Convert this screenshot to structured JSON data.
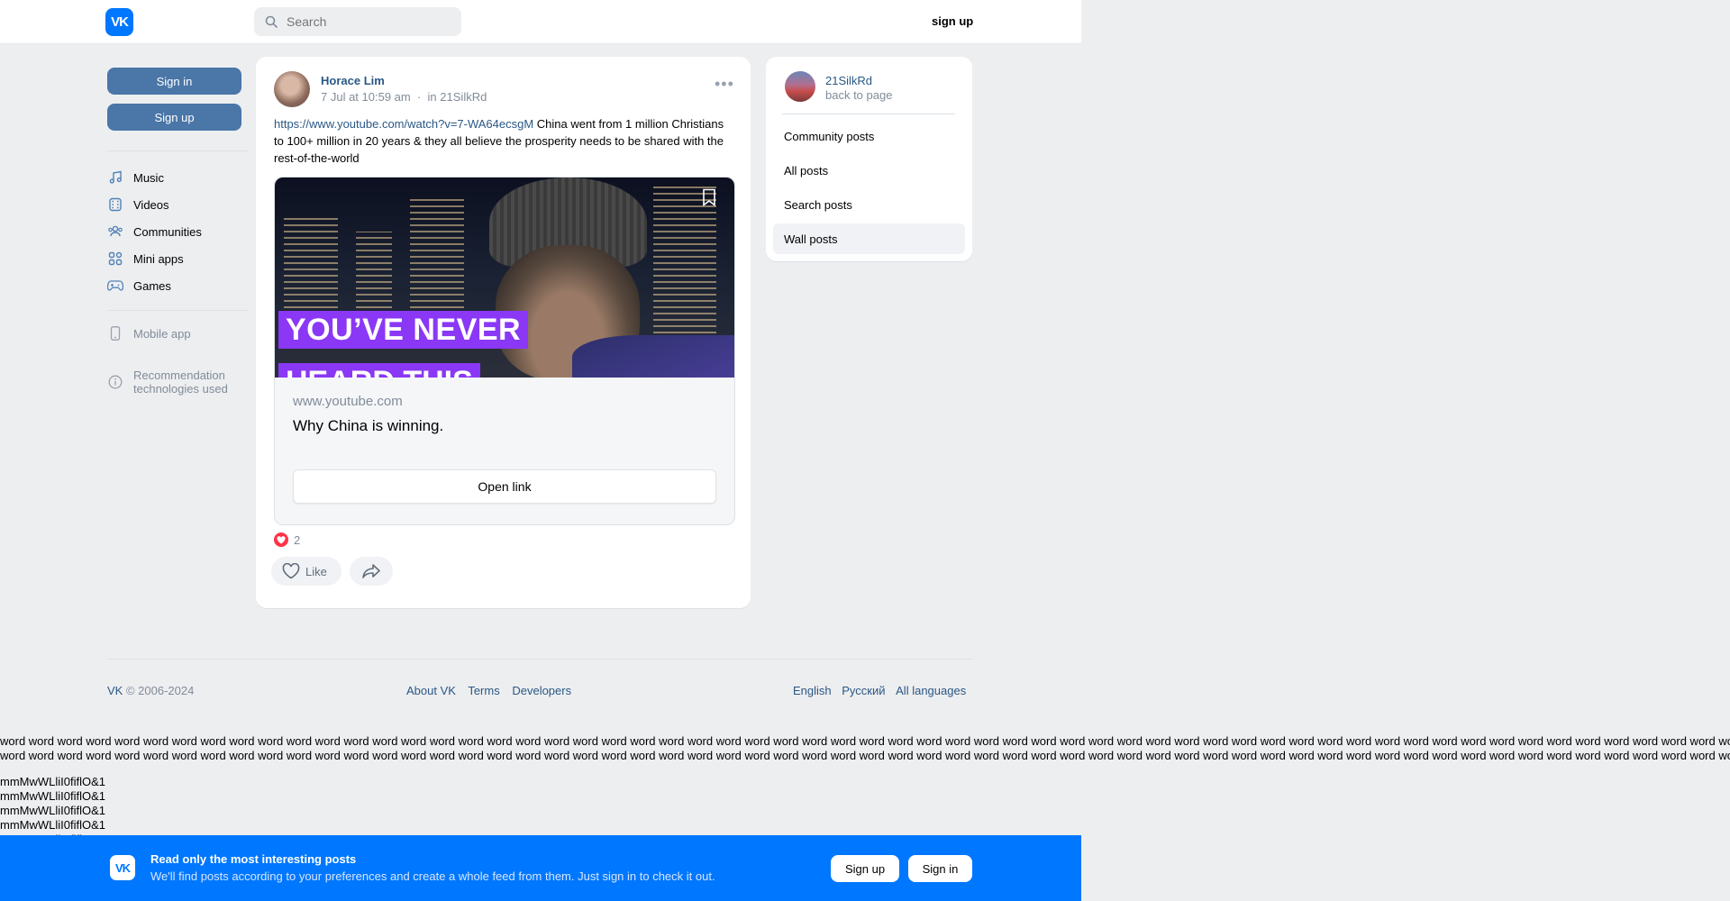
{
  "header": {
    "logo": "VK",
    "search_placeholder": "Search",
    "signup_label": "sign up"
  },
  "sidebar": {
    "signin_label": "Sign in",
    "signup_label": "Sign up",
    "items": [
      {
        "label": "Music",
        "icon": "music-icon"
      },
      {
        "label": "Videos",
        "icon": "video-icon"
      },
      {
        "label": "Communities",
        "icon": "communities-icon"
      },
      {
        "label": "Mini apps",
        "icon": "mini-apps-icon"
      },
      {
        "label": "Games",
        "icon": "games-icon"
      }
    ],
    "mobile_app_label": "Mobile app",
    "recommendation_label_1": "Recommendation",
    "recommendation_label_2": "technologies used"
  },
  "post": {
    "author": "Horace Lim",
    "date": "7 Jul at 10:59 am",
    "separator": "·",
    "group_prefix": "in",
    "group": "21SilkRd",
    "link_url": "https://www.youtube.com/watch?v=7-WA64ecsgM",
    "text": " China went from 1 million Christians to 100+ million in 20 years & they all believe the prosperity needs to be shared with the rest-of-the-world",
    "attachment": {
      "banner_line_1": "YOU’VE NEVER",
      "banner_line_2": "HEARD THIS",
      "domain": "www.youtube.com",
      "title": "Why China is winning.",
      "open_label": "Open link"
    },
    "reactions_count": "2",
    "like_label": "Like"
  },
  "side": {
    "name": "21SilkRd",
    "back_label": "back to page",
    "items": [
      {
        "label": "Community posts",
        "active": false
      },
      {
        "label": "All posts",
        "active": false
      },
      {
        "label": "Search posts",
        "active": false
      },
      {
        "label": "Wall posts",
        "active": true
      }
    ]
  },
  "footer": {
    "copyright_brand": "VK",
    "copyright_rest": " © 2006-2024",
    "links": [
      "About VK",
      "Terms",
      "Developers"
    ],
    "languages": [
      "English",
      "Русский",
      "All languages"
    ]
  },
  "filler": {
    "words_line": "word word word word word word word word word word word word word word word word word word word word word word word word word word word word word word word word word word word word word word word word word word word word word word word word word word word word word word word word word word word word word word word word word word word word word",
    "glyph_line": "mmMwWLliI0fiflO&1"
  },
  "banner": {
    "logo": "VK",
    "title": "Read only the most interesting posts",
    "subtitle": "We'll find posts according to your preferences and create a whole feed from them. Just sign in to check it out.",
    "signup_label": "Sign up",
    "signin_label": "Sign in"
  },
  "colors": {
    "brand_blue": "#0077ff",
    "button_blue": "#4a76a8",
    "link_blue": "#2a5885",
    "page_bg": "#edeef0",
    "heart_red": "#ff3347",
    "banner_purple": "#8a38f5"
  }
}
